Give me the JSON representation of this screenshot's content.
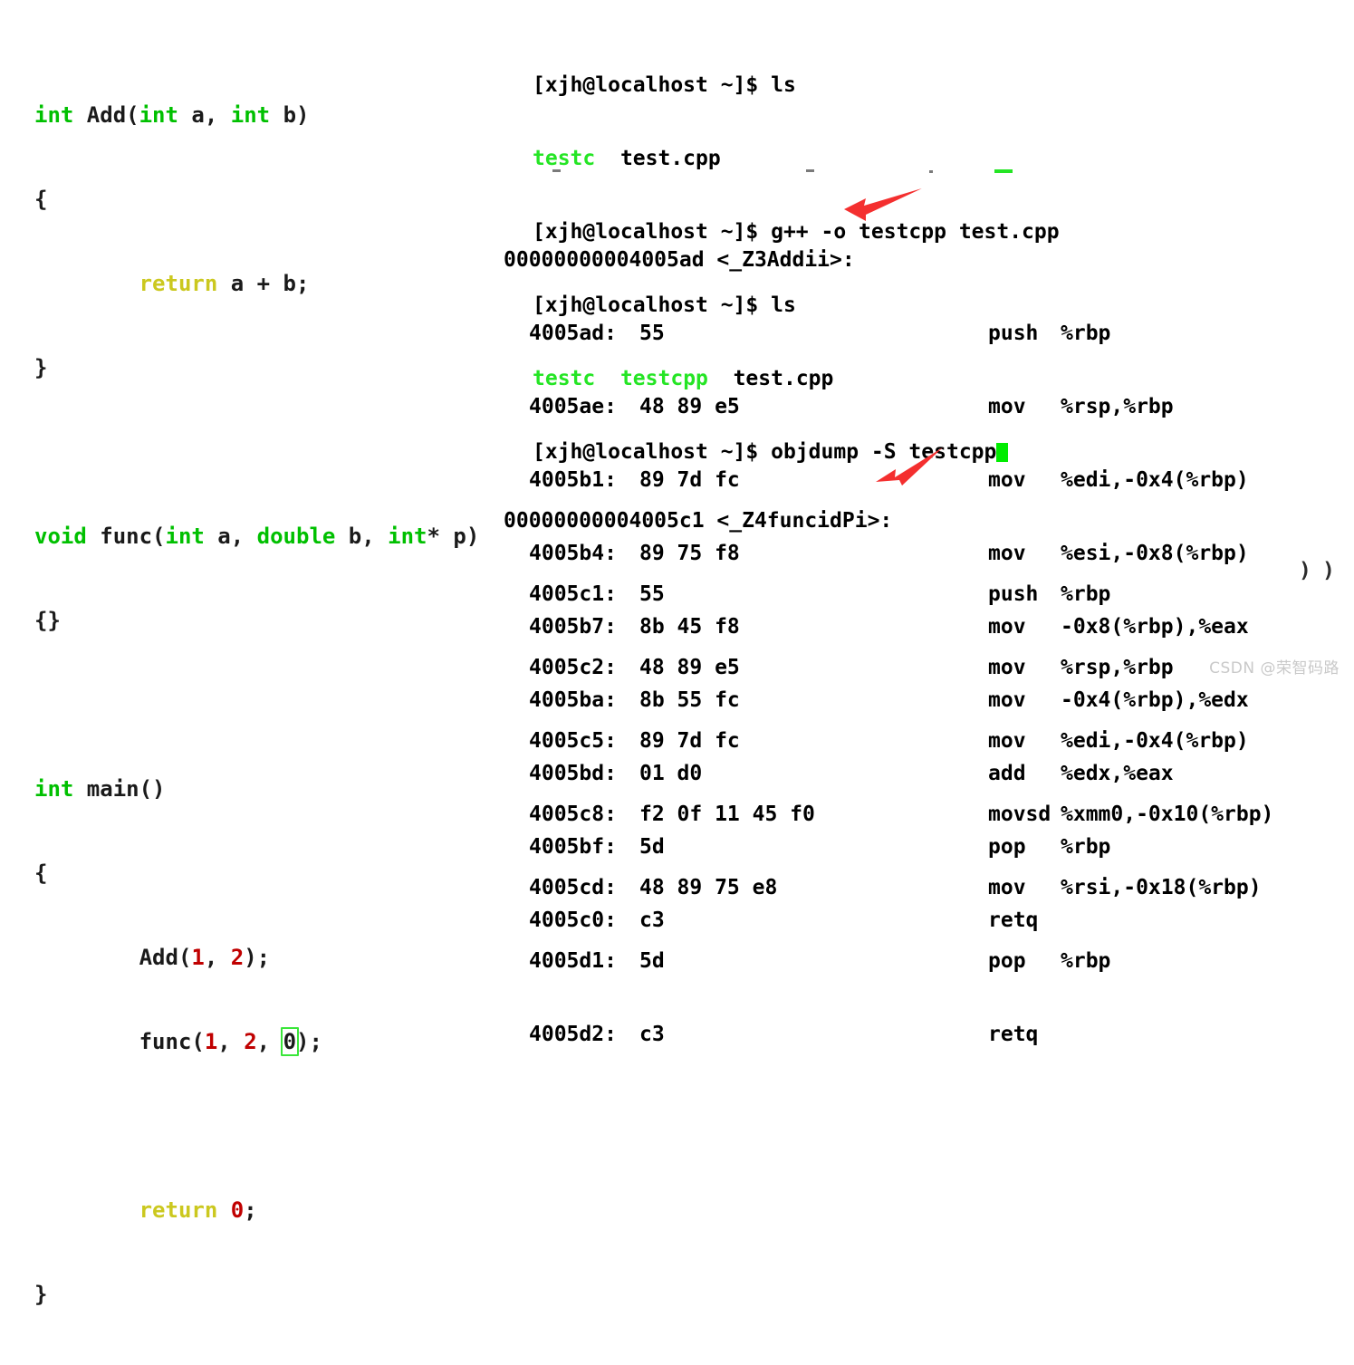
{
  "editor": {
    "language": "C++",
    "colors": {
      "keyword_type": "#00c000",
      "keyword_control": "#cbc81f",
      "number": "#c00000",
      "plain_text": "#1a1a1a",
      "match_box_outline": "#3ae63a"
    },
    "lines": {
      "l1_int": "int",
      "l1_rest": " Add(",
      "l1_int2": "int",
      "l1_a": " a, ",
      "l1_int3": "int",
      "l1_b": " b)",
      "l2": "{",
      "l3_indent": "        ",
      "l3_return": "return",
      "l3_expr": " a + b;",
      "l4": "}",
      "l6_void": "void",
      "l6_name": " func(",
      "l6_int": "int",
      "l6_a": " a, ",
      "l6_double": "double",
      "l6_b": " b, ",
      "l6_intp": "int",
      "l6_p": "* p)",
      "l7": "{}",
      "l9_int": "int",
      "l9_main": " main()",
      "l10": "{",
      "l11_indent": "        ",
      "l11_call": "Add(",
      "l11_n1": "1",
      "l11_sep": ", ",
      "l11_n2": "2",
      "l11_end": ");",
      "l12_indent": "        ",
      "l12_call": "func(",
      "l12_n1": "1",
      "l12_sep1": ", ",
      "l12_n2": "2",
      "l12_sep2": ", ",
      "l12_n3": "0",
      "l12_end": ");",
      "l14_indent": "        ",
      "l14_return": "return",
      "l14_space": " ",
      "l14_n": "0",
      "l14_semi": ";",
      "l15": "}"
    }
  },
  "terminal": {
    "prompt": "[xjh@localhost ~]$ ",
    "colors": {
      "foreground": "#000000",
      "background": "#ffffff",
      "executable_green": "#25e525",
      "cursor": "#00ec00"
    },
    "session": [
      {
        "prompt": "[xjh@localhost ~]$ ",
        "command": "ls"
      },
      {
        "output_green": "testc",
        "output_gap": "  ",
        "output_plain": "test.cpp"
      },
      {
        "prompt": "[xjh@localhost ~]$ ",
        "command": "g++ -o testcpp test.cpp"
      },
      {
        "prompt": "[xjh@localhost ~]$ ",
        "command": "ls"
      },
      {
        "output_green": "testc",
        "output_gap": "  ",
        "output_green2": "testcpp",
        "output_gap2": "  ",
        "output_plain": "test.cpp"
      },
      {
        "prompt": "[xjh@localhost ~]$ ",
        "command": "objdump -S testcpp",
        "cursor": true
      }
    ],
    "flat": {
      "line1_prompt": "[xjh@localhost ~]$ ",
      "line1_cmd": "ls",
      "line2_a": "testc",
      "line2_b": "  test.cpp",
      "line3_prompt": "[xjh@localhost ~]$ ",
      "line3_cmd": "g++ -o testcpp test.cpp",
      "line4_prompt": "[xjh@localhost ~]$ ",
      "line4_cmd": "ls",
      "line5_a": "testc",
      "line5_gap": "  ",
      "line5_b": "testcpp",
      "line5_c": "  test.cpp",
      "line6_prompt": "[xjh@localhost ~]$ ",
      "line6_cmd": "objdump -S testcpp"
    }
  },
  "disassembly": [
    {
      "header": "00000000004005ad <_Z3Addii>:",
      "rows": [
        {
          "address": "4005ad:",
          "bytes": "55",
          "mnemonic": "push",
          "operands": "%rbp"
        },
        {
          "address": "4005ae:",
          "bytes": "48 89 e5",
          "mnemonic": "mov",
          "operands": "%rsp,%rbp"
        },
        {
          "address": "4005b1:",
          "bytes": "89 7d fc",
          "mnemonic": "mov",
          "operands": "%edi,-0x4(%rbp)"
        },
        {
          "address": "4005b4:",
          "bytes": "89 75 f8",
          "mnemonic": "mov",
          "operands": "%esi,-0x8(%rbp)"
        },
        {
          "address": "4005b7:",
          "bytes": "8b 45 f8",
          "mnemonic": "mov",
          "operands": "-0x8(%rbp),%eax"
        },
        {
          "address": "4005ba:",
          "bytes": "8b 55 fc",
          "mnemonic": "mov",
          "operands": "-0x4(%rbp),%edx"
        },
        {
          "address": "4005bd:",
          "bytes": "01 d0",
          "mnemonic": "add",
          "operands": "%edx,%eax"
        },
        {
          "address": "4005bf:",
          "bytes": "5d",
          "mnemonic": "pop",
          "operands": "%rbp"
        },
        {
          "address": "4005c0:",
          "bytes": "c3",
          "mnemonic": "retq",
          "operands": ""
        }
      ]
    },
    {
      "header": "00000000004005c1 <_Z4funcidPi>:",
      "rows": [
        {
          "address": "4005c1:",
          "bytes": "55",
          "mnemonic": "push",
          "operands": "%rbp"
        },
        {
          "address": "4005c2:",
          "bytes": "48 89 e5",
          "mnemonic": "mov",
          "operands": "%rsp,%rbp"
        },
        {
          "address": "4005c5:",
          "bytes": "89 7d fc",
          "mnemonic": "mov",
          "operands": "%edi,-0x4(%rbp)"
        },
        {
          "address": "4005c8:",
          "bytes": "f2 0f 11 45 f0",
          "mnemonic": "movsd",
          "operands": "%xmm0,-0x10(%rbp)"
        },
        {
          "address": "4005cd:",
          "bytes": "48 89 75 e8",
          "mnemonic": "mov",
          "operands": "%rsi,-0x18(%rbp)"
        },
        {
          "address": "4005d1:",
          "bytes": "5d",
          "mnemonic": "pop",
          "operands": "%rbp"
        },
        {
          "address": "4005d2:",
          "bytes": "c3",
          "mnemonic": "retq",
          "operands": ""
        }
      ]
    }
  ],
  "annotations": {
    "color": "#f42f2f",
    "arrows": [
      {
        "name": "arrow-to-add-mangled-name",
        "target": "_Z3Addii"
      },
      {
        "name": "arrow-to-func-mangled-name",
        "target": "_Z4funcidPi"
      }
    ]
  },
  "artifacts": {
    "paren_1": ")",
    "paren_2": ")"
  },
  "watermark": {
    "text": "CSDN @荣智码路"
  }
}
